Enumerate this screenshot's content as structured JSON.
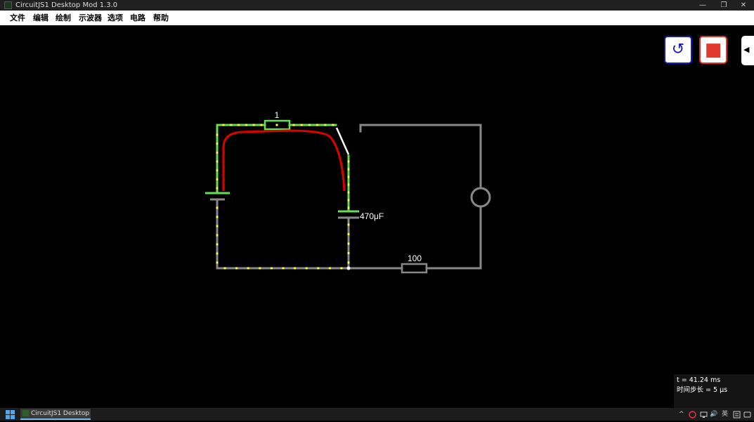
{
  "window": {
    "title": "CircuitJS1 Desktop Mod 1.3.0",
    "controls": {
      "minimize": "—",
      "restore": "❐",
      "close": "✕"
    }
  },
  "menu": [
    "文件",
    "编辑",
    "绘制",
    "示波器",
    "选项",
    "电路",
    "帮助"
  ],
  "circuit": {
    "labels": {
      "resistor_top": "1",
      "capacitor": "470μF",
      "resistor_bottom": "100"
    },
    "colors": {
      "energized": "#66dd55",
      "ground": "#888888",
      "current_dots": "#ffff44",
      "scope_trace": "#dd0000",
      "switch": "#ffffff"
    }
  },
  "controls": {
    "reset_icon": "↺",
    "stop_icon": "■",
    "sidebar_toggle_icon": "◀"
  },
  "info": {
    "time": "t = 41.24 ms",
    "timestep": "时间步长 = 5 μs"
  },
  "taskbar": {
    "app_label": "CircuitJS1 Desktop M...",
    "tray": {
      "chevron": "^",
      "volume": "🔊",
      "ime": "英"
    }
  }
}
